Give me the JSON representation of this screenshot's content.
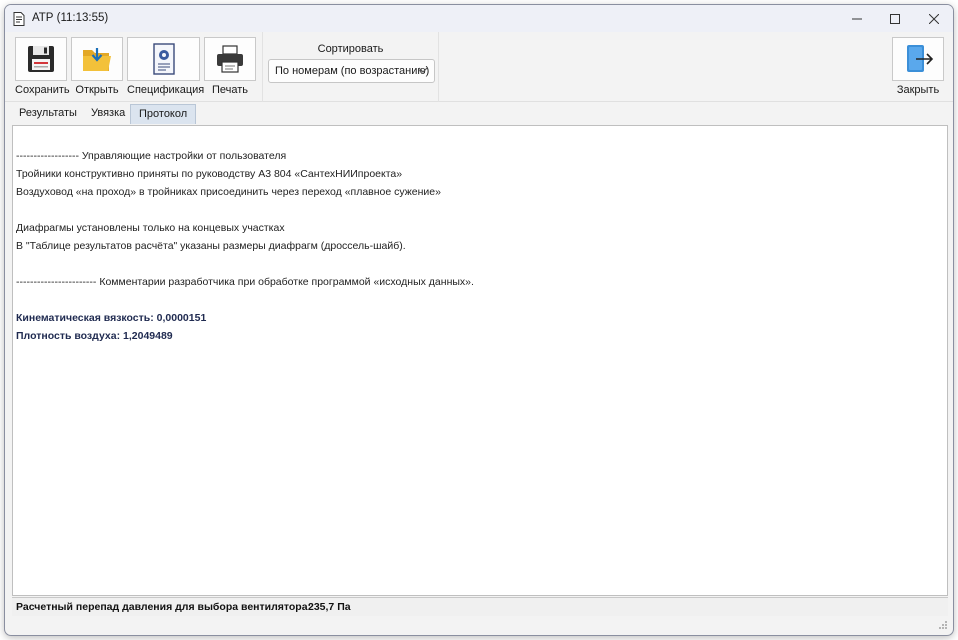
{
  "window": {
    "title": "АТР (11:13:55)",
    "icons": {
      "app": "document-icon",
      "minimize": "minimize-icon",
      "maximize": "maximize-icon",
      "close": "close-icon"
    }
  },
  "toolbar": {
    "save_label": "Сохранить",
    "open_label": "Открыть",
    "spec_label": "Спецификация",
    "print_label": "Печать",
    "close_label": "Закрыть",
    "icons": {
      "save": "floppy-disk-icon",
      "open": "folder-open-icon",
      "spec": "specification-document-icon",
      "print": "printer-icon",
      "close": "exit-door-icon"
    }
  },
  "sort": {
    "label": "Сортировать",
    "selected": "По номерам (по возрастанию)"
  },
  "tabs": [
    {
      "label": "Результаты",
      "active": false
    },
    {
      "label": "Увязка",
      "active": false
    },
    {
      "label": "Протокол",
      "active": true
    }
  ],
  "protocol": {
    "lines": [
      "------------------ Управляющие настройки от пользователя",
      "Тройники конструктивно приняты по руководству А3 804 «СантехНИИпроекта»",
      "Воздуховод «на проход» в тройниках присоединить через переход «плавное сужение»",
      "Диафрагмы установлены только на концевых участках",
      "В \"Таблице результатов расчёта\" указаны размеры диафрагм (дроссель-шайб).",
      "----------------------- Комментарии разработчика при обработке программой «исходных данных».",
      "Кинематическая вязкость: 0,0000151",
      "Плотность воздуха: 1,2049489"
    ]
  },
  "status": {
    "label": "Расчетный перепад давления для выбора вентилятора:",
    "value": "235,7 Па"
  },
  "colors": {
    "window_bg": "#f3f3f3",
    "active_tab": "#dbe4ef",
    "bold_text": "#1f2a50",
    "folder_yellow": "#f3c13a",
    "exit_blue": "#3b8fd8"
  }
}
